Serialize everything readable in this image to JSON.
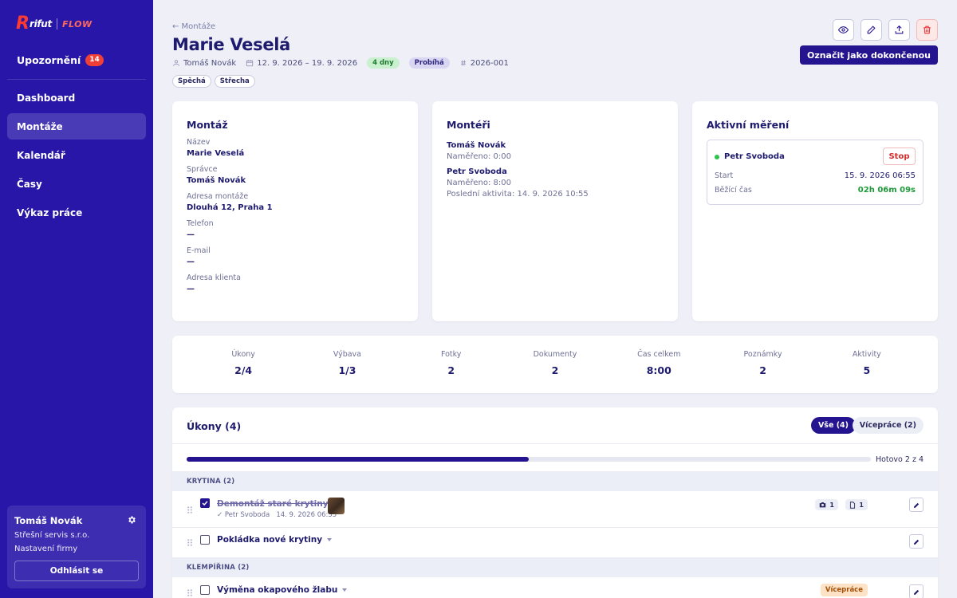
{
  "brand": {
    "logo_r": "R",
    "logo_rest": "rifut",
    "logo_flow": "FLOW"
  },
  "sidebar": {
    "notifications": {
      "label": "Upozornění",
      "count": "14"
    },
    "items": [
      {
        "label": "Dashboard"
      },
      {
        "label": "Montáže"
      },
      {
        "label": "Kalendář"
      },
      {
        "label": "Časy"
      },
      {
        "label": "Výkaz práce"
      }
    ],
    "active_index": 1,
    "user": {
      "name": "Tomáš Novák",
      "company": "Střešní servis s.r.o.",
      "settings_label": "Nastavení firmy",
      "logout_label": "Odhlásit se"
    }
  },
  "header": {
    "back_label": "← Montáže",
    "title": "Marie Veselá",
    "manager": "Tomáš Novák",
    "date_range": "12. 9. 2026 – 19. 9. 2026",
    "duration": "4 dny",
    "status": "Probíhá",
    "code": "2026-001",
    "tags": [
      "Spěchá",
      "Střecha"
    ],
    "complete_button": "Označit jako dokončenou"
  },
  "montaz_card": {
    "title": "Montáž",
    "fields": [
      {
        "label": "Název",
        "value": "Marie Veselá"
      },
      {
        "label": "Správce",
        "value": "Tomáš Novák"
      },
      {
        "label": "Adresa montáže",
        "value": "Dlouhá 12, Praha 1"
      },
      {
        "label": "Telefon",
        "value": "—"
      },
      {
        "label": "E-mail",
        "value": "—"
      },
      {
        "label": "Adresa klienta",
        "value": "—"
      }
    ]
  },
  "fitters_card": {
    "title": "Montéři",
    "fitters": [
      {
        "name": "Tomáš Novák",
        "measured": "Naměřeno: 0:00"
      },
      {
        "name": "Petr Svoboda",
        "measured": "Naměřeno: 8:00",
        "last_activity": "Poslední aktivita: 14. 9. 2026 10:55"
      }
    ]
  },
  "timer_card": {
    "title": "Aktivní měření",
    "person": "Petr Svoboda",
    "stop_label": "Stop",
    "start_label": "Start",
    "start_value": "15. 9. 2026 06:55",
    "running_label": "Běžící čas",
    "running_value": "02h 06m 09s",
    "status_color": "#2ec24f"
  },
  "stats": [
    {
      "label": "Úkony",
      "value": "2/4"
    },
    {
      "label": "Výbava",
      "value": "1/3"
    },
    {
      "label": "Fotky",
      "value": "2"
    },
    {
      "label": "Dokumenty",
      "value": "2"
    },
    {
      "label": "Čas celkem",
      "value": "8:00"
    },
    {
      "label": "Poznámky",
      "value": "2"
    },
    {
      "label": "Aktivity",
      "value": "5"
    }
  ],
  "tasks": {
    "title": "Úkony (4)",
    "filters": [
      {
        "label": "Vše (4)",
        "active": true
      },
      {
        "label": "Vícepráce (2)",
        "active": false
      }
    ],
    "progress_fraction": 0.5,
    "progress_label": "Hotovo 2 z 4",
    "groups": [
      {
        "name": "KRYTINA (2)",
        "items": [
          {
            "name": "Demontáž staré krytiny",
            "done": true,
            "sub": "✓ Petr Svoboda   14. 9. 2026 06:55",
            "photos": "1",
            "docs": "1"
          },
          {
            "name": "Pokládka nové krytiny",
            "done": false
          }
        ]
      },
      {
        "name": "KLEMPÍŘINA (2)",
        "items": [
          {
            "name": "Výměna okapového žlabu",
            "done": false,
            "badge": "Vícepráce"
          }
        ]
      }
    ]
  },
  "colors": {
    "sidebar": "#2716a8",
    "primary": "#24148f",
    "danger": "#ef3f37",
    "success": "#2ec24f"
  }
}
